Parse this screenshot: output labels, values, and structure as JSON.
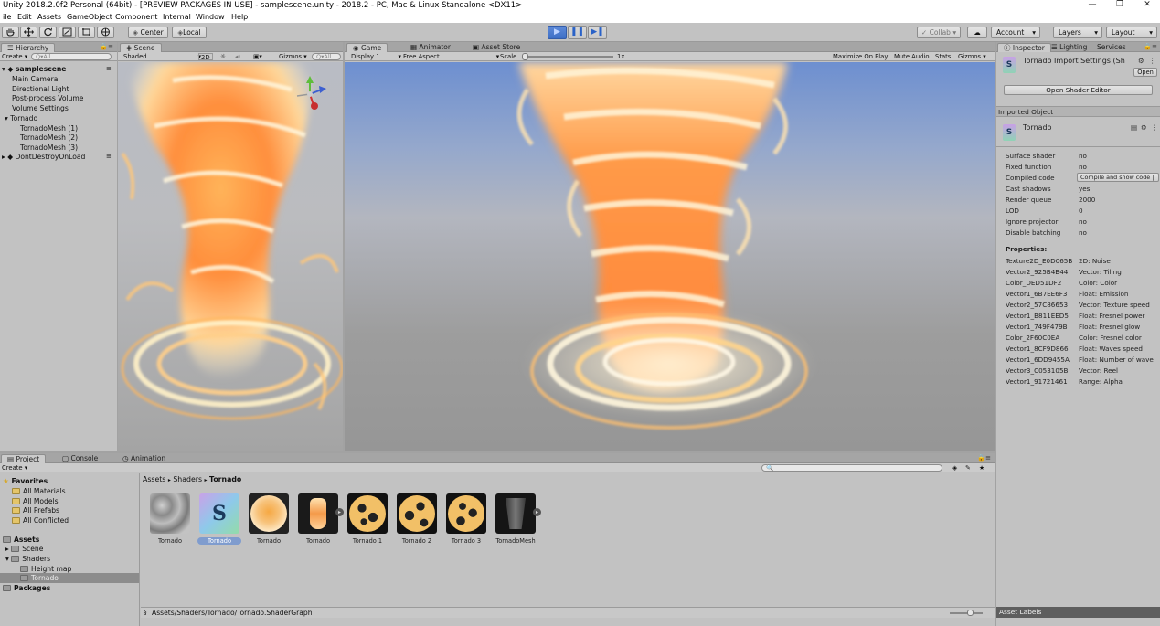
{
  "window": {
    "title": "Unity 2018.2.0f2 Personal (64bit) - [PREVIEW PACKAGES IN USE] - samplescene.unity - 2018.2 - PC, Mac & Linux Standalone <DX11>",
    "minimize": "—",
    "restore": "❐",
    "close": "✕"
  },
  "menu": [
    "ile",
    "Edit",
    "Assets",
    "GameObject",
    "Component",
    "Internal",
    "Window",
    "Help"
  ],
  "toolbar": {
    "pivot": "Center",
    "space": "Local",
    "collab": "Collab",
    "account": "Account",
    "layers": "Layers",
    "layout": "Layout"
  },
  "hierarchy": {
    "tab": "Hierarchy",
    "create": "Create",
    "search_placeholder": "Q▾All",
    "scene": "samplescene",
    "items": [
      "Main Camera",
      "Directional Light",
      "Post-process Volume",
      "Volume Settings",
      "Tornado",
      "TornadoMesh (1)",
      "TornadoMesh (2)",
      "TornadoMesh (3)"
    ],
    "dont_destroy": "DontDestroyOnLoad"
  },
  "scene_view": {
    "tab": "Scene",
    "shading": "Shaded",
    "mode2d": "2D",
    "gizmos": "Gizmos",
    "search": "Q▾All"
  },
  "game_view": {
    "tabs": [
      "Game",
      "Animator",
      "Asset Store"
    ],
    "display": "Display 1",
    "aspect": "Free Aspect",
    "scale_label": "Scale",
    "scale_value": "1x",
    "maximize": "Maximize On Play",
    "mute": "Mute Audio",
    "stats": "Stats",
    "gizmos": "Gizmos"
  },
  "inspector": {
    "tabs": [
      "Inspector",
      "Lighting",
      "Services"
    ],
    "header_title": "Tornado Import Settings (Sh",
    "open": "Open",
    "open_shader_editor": "Open Shader Editor",
    "imported_object_label": "Imported Object",
    "object_name": "Tornado",
    "rows": [
      {
        "k": "Surface shader",
        "v": "no"
      },
      {
        "k": "Fixed function",
        "v": "no"
      },
      {
        "k": "Compiled code",
        "v": "Compile and show code |"
      },
      {
        "k": "Cast shadows",
        "v": "yes"
      },
      {
        "k": "Render queue",
        "v": "2000"
      },
      {
        "k": "LOD",
        "v": "0"
      },
      {
        "k": "Ignore projector",
        "v": "no"
      },
      {
        "k": "Disable batching",
        "v": "no"
      }
    ],
    "properties_label": "Properties:",
    "properties": [
      {
        "k": "Texture2D_E0D065B",
        "v": "2D: Noise"
      },
      {
        "k": "Vector2_925B4B44",
        "v": "Vector: Tiling"
      },
      {
        "k": "Color_DED51DF2",
        "v": "Color: Color"
      },
      {
        "k": "Vector1_6B7EE6F3",
        "v": "Float: Emission"
      },
      {
        "k": "Vector2_57C86653",
        "v": "Vector: Texture speed"
      },
      {
        "k": "Vector1_B811EED5",
        "v": "Float: Fresnel power"
      },
      {
        "k": "Vector1_749F479B",
        "v": "Float: Fresnel glow"
      },
      {
        "k": "Color_2F60C0EA",
        "v": "Color: Fresnel color"
      },
      {
        "k": "Vector1_8CF9D866",
        "v": "Float: Waves speed"
      },
      {
        "k": "Vector1_6DD9455A",
        "v": "Float: Number of wave"
      },
      {
        "k": "Vector3_C053105B",
        "v": "Vector: Reel"
      },
      {
        "k": "Vector1_91721461",
        "v": "Range: Alpha"
      }
    ],
    "asset_labels": "Asset Labels"
  },
  "project": {
    "tabs": [
      "Project",
      "Console",
      "Animation"
    ],
    "create": "Create",
    "favorites_label": "Favorites",
    "favorites": [
      "All Materials",
      "All Models",
      "All Prefabs",
      "All Conflicted"
    ],
    "assets_label": "Assets",
    "tree": [
      "Scene",
      "Shaders",
      "Height map",
      "Tornado"
    ],
    "packages_label": "Packages",
    "breadcrumb": [
      "Assets",
      "Shaders",
      "Tornado"
    ],
    "breadcrumb_sep": "▸",
    "assets": [
      "Tornado",
      "Tornado",
      "Tornado",
      "Tornado",
      "Tornado 1",
      "Tornado 2",
      "Tornado 3",
      "TornadoMesh"
    ],
    "selected_index": 1,
    "status_path": "Assets/Shaders/Tornado/Tornado.ShaderGraph"
  }
}
